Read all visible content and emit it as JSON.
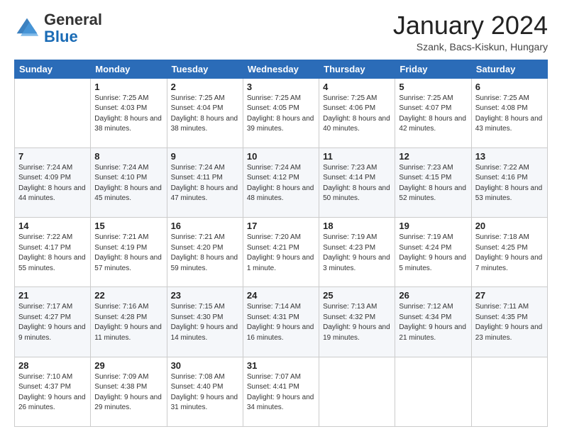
{
  "header": {
    "logo_general": "General",
    "logo_blue": "Blue",
    "month_title": "January 2024",
    "location": "Szank, Bacs-Kiskun, Hungary"
  },
  "days_of_week": [
    "Sunday",
    "Monday",
    "Tuesday",
    "Wednesday",
    "Thursday",
    "Friday",
    "Saturday"
  ],
  "weeks": [
    [
      {
        "day": "",
        "sunrise": "",
        "sunset": "",
        "daylight": ""
      },
      {
        "day": "1",
        "sunrise": "Sunrise: 7:25 AM",
        "sunset": "Sunset: 4:03 PM",
        "daylight": "Daylight: 8 hours and 38 minutes."
      },
      {
        "day": "2",
        "sunrise": "Sunrise: 7:25 AM",
        "sunset": "Sunset: 4:04 PM",
        "daylight": "Daylight: 8 hours and 38 minutes."
      },
      {
        "day": "3",
        "sunrise": "Sunrise: 7:25 AM",
        "sunset": "Sunset: 4:05 PM",
        "daylight": "Daylight: 8 hours and 39 minutes."
      },
      {
        "day": "4",
        "sunrise": "Sunrise: 7:25 AM",
        "sunset": "Sunset: 4:06 PM",
        "daylight": "Daylight: 8 hours and 40 minutes."
      },
      {
        "day": "5",
        "sunrise": "Sunrise: 7:25 AM",
        "sunset": "Sunset: 4:07 PM",
        "daylight": "Daylight: 8 hours and 42 minutes."
      },
      {
        "day": "6",
        "sunrise": "Sunrise: 7:25 AM",
        "sunset": "Sunset: 4:08 PM",
        "daylight": "Daylight: 8 hours and 43 minutes."
      }
    ],
    [
      {
        "day": "7",
        "sunrise": "Sunrise: 7:24 AM",
        "sunset": "Sunset: 4:09 PM",
        "daylight": "Daylight: 8 hours and 44 minutes."
      },
      {
        "day": "8",
        "sunrise": "Sunrise: 7:24 AM",
        "sunset": "Sunset: 4:10 PM",
        "daylight": "Daylight: 8 hours and 45 minutes."
      },
      {
        "day": "9",
        "sunrise": "Sunrise: 7:24 AM",
        "sunset": "Sunset: 4:11 PM",
        "daylight": "Daylight: 8 hours and 47 minutes."
      },
      {
        "day": "10",
        "sunrise": "Sunrise: 7:24 AM",
        "sunset": "Sunset: 4:12 PM",
        "daylight": "Daylight: 8 hours and 48 minutes."
      },
      {
        "day": "11",
        "sunrise": "Sunrise: 7:23 AM",
        "sunset": "Sunset: 4:14 PM",
        "daylight": "Daylight: 8 hours and 50 minutes."
      },
      {
        "day": "12",
        "sunrise": "Sunrise: 7:23 AM",
        "sunset": "Sunset: 4:15 PM",
        "daylight": "Daylight: 8 hours and 52 minutes."
      },
      {
        "day": "13",
        "sunrise": "Sunrise: 7:22 AM",
        "sunset": "Sunset: 4:16 PM",
        "daylight": "Daylight: 8 hours and 53 minutes."
      }
    ],
    [
      {
        "day": "14",
        "sunrise": "Sunrise: 7:22 AM",
        "sunset": "Sunset: 4:17 PM",
        "daylight": "Daylight: 8 hours and 55 minutes."
      },
      {
        "day": "15",
        "sunrise": "Sunrise: 7:21 AM",
        "sunset": "Sunset: 4:19 PM",
        "daylight": "Daylight: 8 hours and 57 minutes."
      },
      {
        "day": "16",
        "sunrise": "Sunrise: 7:21 AM",
        "sunset": "Sunset: 4:20 PM",
        "daylight": "Daylight: 8 hours and 59 minutes."
      },
      {
        "day": "17",
        "sunrise": "Sunrise: 7:20 AM",
        "sunset": "Sunset: 4:21 PM",
        "daylight": "Daylight: 9 hours and 1 minute."
      },
      {
        "day": "18",
        "sunrise": "Sunrise: 7:19 AM",
        "sunset": "Sunset: 4:23 PM",
        "daylight": "Daylight: 9 hours and 3 minutes."
      },
      {
        "day": "19",
        "sunrise": "Sunrise: 7:19 AM",
        "sunset": "Sunset: 4:24 PM",
        "daylight": "Daylight: 9 hours and 5 minutes."
      },
      {
        "day": "20",
        "sunrise": "Sunrise: 7:18 AM",
        "sunset": "Sunset: 4:25 PM",
        "daylight": "Daylight: 9 hours and 7 minutes."
      }
    ],
    [
      {
        "day": "21",
        "sunrise": "Sunrise: 7:17 AM",
        "sunset": "Sunset: 4:27 PM",
        "daylight": "Daylight: 9 hours and 9 minutes."
      },
      {
        "day": "22",
        "sunrise": "Sunrise: 7:16 AM",
        "sunset": "Sunset: 4:28 PM",
        "daylight": "Daylight: 9 hours and 11 minutes."
      },
      {
        "day": "23",
        "sunrise": "Sunrise: 7:15 AM",
        "sunset": "Sunset: 4:30 PM",
        "daylight": "Daylight: 9 hours and 14 minutes."
      },
      {
        "day": "24",
        "sunrise": "Sunrise: 7:14 AM",
        "sunset": "Sunset: 4:31 PM",
        "daylight": "Daylight: 9 hours and 16 minutes."
      },
      {
        "day": "25",
        "sunrise": "Sunrise: 7:13 AM",
        "sunset": "Sunset: 4:32 PM",
        "daylight": "Daylight: 9 hours and 19 minutes."
      },
      {
        "day": "26",
        "sunrise": "Sunrise: 7:12 AM",
        "sunset": "Sunset: 4:34 PM",
        "daylight": "Daylight: 9 hours and 21 minutes."
      },
      {
        "day": "27",
        "sunrise": "Sunrise: 7:11 AM",
        "sunset": "Sunset: 4:35 PM",
        "daylight": "Daylight: 9 hours and 23 minutes."
      }
    ],
    [
      {
        "day": "28",
        "sunrise": "Sunrise: 7:10 AM",
        "sunset": "Sunset: 4:37 PM",
        "daylight": "Daylight: 9 hours and 26 minutes."
      },
      {
        "day": "29",
        "sunrise": "Sunrise: 7:09 AM",
        "sunset": "Sunset: 4:38 PM",
        "daylight": "Daylight: 9 hours and 29 minutes."
      },
      {
        "day": "30",
        "sunrise": "Sunrise: 7:08 AM",
        "sunset": "Sunset: 4:40 PM",
        "daylight": "Daylight: 9 hours and 31 minutes."
      },
      {
        "day": "31",
        "sunrise": "Sunrise: 7:07 AM",
        "sunset": "Sunset: 4:41 PM",
        "daylight": "Daylight: 9 hours and 34 minutes."
      },
      {
        "day": "",
        "sunrise": "",
        "sunset": "",
        "daylight": ""
      },
      {
        "day": "",
        "sunrise": "",
        "sunset": "",
        "daylight": ""
      },
      {
        "day": "",
        "sunrise": "",
        "sunset": "",
        "daylight": ""
      }
    ]
  ]
}
